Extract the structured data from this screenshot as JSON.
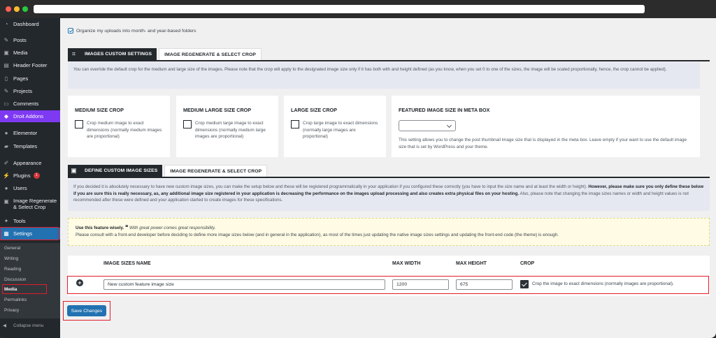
{
  "window": {
    "dot_colors": [
      "#ff5f57",
      "#febc2e",
      "#28c840"
    ]
  },
  "sidebar": {
    "items": [
      {
        "name": "dashboard",
        "label": "Dashboard",
        "icon": "dashboard-icon"
      },
      {
        "name": "posts",
        "label": "Posts",
        "icon": "pin-icon"
      },
      {
        "name": "media",
        "label": "Media",
        "icon": "media-icon"
      },
      {
        "name": "header-footer",
        "label": "Header Footer",
        "icon": "layout-icon"
      },
      {
        "name": "pages",
        "label": "Pages",
        "icon": "page-icon"
      },
      {
        "name": "projects",
        "label": "Projects",
        "icon": "pin-icon"
      },
      {
        "name": "comments",
        "label": "Comments",
        "icon": "comment-icon"
      },
      {
        "name": "droit-addons",
        "label": "Droit Addons",
        "icon": "droit-icon"
      },
      {
        "name": "elementor",
        "label": "Elementor",
        "icon": "elementor-icon"
      },
      {
        "name": "templates",
        "label": "Templates",
        "icon": "folder-icon"
      },
      {
        "name": "appearance",
        "label": "Appearance",
        "icon": "brush-icon"
      },
      {
        "name": "plugins",
        "label": "Plugins",
        "icon": "plugin-icon",
        "badge": "1"
      },
      {
        "name": "users",
        "label": "Users",
        "icon": "user-icon"
      },
      {
        "name": "image-regenerate",
        "label": "Image Regenerate & Select Crop",
        "icon": "image-icon"
      },
      {
        "name": "tools",
        "label": "Tools",
        "icon": "wrench-icon"
      },
      {
        "name": "settings",
        "label": "Settings",
        "icon": "settings-icon"
      }
    ],
    "submenu": [
      "General",
      "Writing",
      "Reading",
      "Discussion",
      "Media",
      "Permalinks",
      "Privacy"
    ],
    "collapse_label": "Collapse menu"
  },
  "organize": {
    "label": "Organize my uploads into month- and year-based folders",
    "checked": true
  },
  "section1": {
    "tab_active": "IMAGES CUSTOM SETTINGS",
    "tab_inactive": "IMAGE REGENERATE & SELECT CROP",
    "info": "You can override the default crop for the medium and large size of the images. Please note that the crop will apply to the designated image size only if it has both with and height defined (as you know, when you set 0 to one of the sizes, the image will be scaled proportionally, hence, the crop cannot be applied).",
    "cards": [
      {
        "title": "MEDIUM SIZE CROP",
        "text": "Crop medium image to exact dimensions (normally medium images are proportional)"
      },
      {
        "title": "MEDIUM LARGE SIZE CROP",
        "text": "Crop medium large image to exact dimensions (normally medium large images are proportional)"
      },
      {
        "title": "LARGE SIZE CROP",
        "text": "Crop large image to exact dimensions (normally large images are proportional)"
      }
    ],
    "featured": {
      "title": "FEATURED IMAGE SIZE IN META BOX",
      "select_value": "",
      "text": "This setting allows you to change the post thumbnail image size that is displayed in the meta box. Leave empty if your want to use the default image size that is set by WordPress and your theme."
    }
  },
  "section2": {
    "tab_active": "DEFINE CUSTOM IMAGE SIZES",
    "tab_inactive": "IMAGE REGENERATE & SELECT CROP",
    "info_a": "If you decided it is absolutely necessary to have new custom image sizes, you can make the setup below and these will be registered programmatically in your application if you configured these correctly (you have to input the size name and at least the width or height). ",
    "info_b": "However, please make sure you only define these below if you are sure this is really necessary, as, any additional image size registered in your application is decreasing the performance on the images upload processing and also creates extra physical files on your hosting.",
    "info_c": " Also, please note that changing the image sizes names or width and height values is not recommended after these were defined and your application started to create images for these specifications."
  },
  "notice": {
    "bold": "Use this feature wisely.",
    "quote_mark": "❝",
    "quote": "With great power comes great responsibility.",
    "text": "Please consult with a front-end developer before deciding to define more image sizes below (and in general in the application), as most of the times just updating the native image sizes settings and updating the front-end code (the theme) is enough."
  },
  "table": {
    "headers": {
      "name": "IMAGE SIZES NAME",
      "width": "MAX WIDTH",
      "height": "MAX HEIGHT",
      "crop": "CROP"
    },
    "row": {
      "name": "New custom feature image size",
      "width": "1200",
      "height": "675",
      "crop_checked": true,
      "crop_label": "Crop the image to exact dimensions (normally images are proportional)."
    }
  },
  "save_button": "Save Changes",
  "highlight_color": "#e11d2a"
}
